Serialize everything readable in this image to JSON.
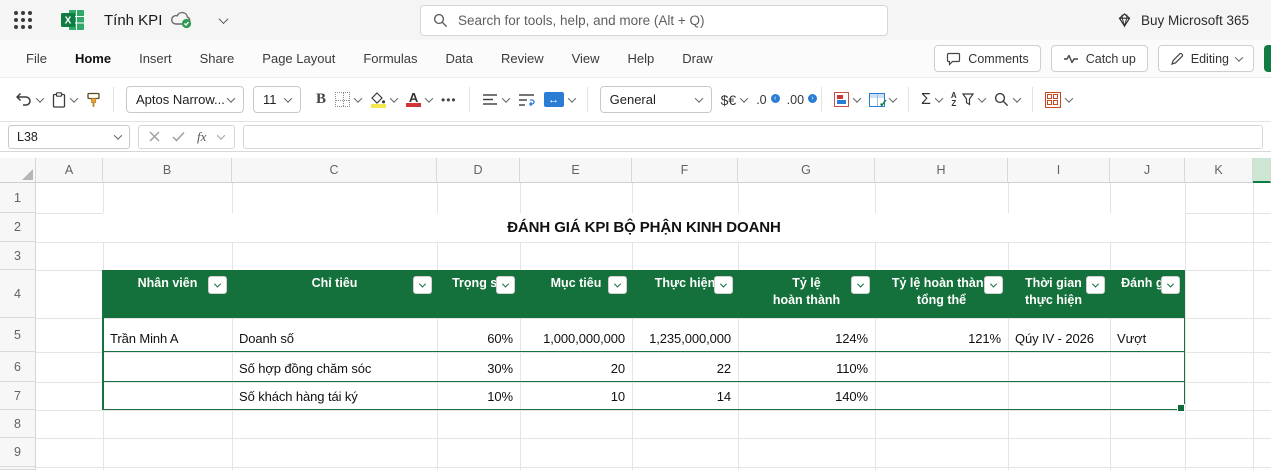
{
  "topbar": {
    "doc_title": "Tính KPI",
    "search_placeholder": "Search for tools, help, and more (Alt + Q)",
    "buy_label": "Buy Microsoft 365"
  },
  "menubar": {
    "items": [
      "File",
      "Home",
      "Insert",
      "Share",
      "Page Layout",
      "Formulas",
      "Data",
      "Review",
      "View",
      "Help",
      "Draw"
    ],
    "active_item": "Home",
    "comments_label": "Comments",
    "catchup_label": "Catch up",
    "editing_label": "Editing"
  },
  "ribbon": {
    "font_name": "Aptos Narrow...",
    "font_size": "11",
    "number_format": "General",
    "bold_glyph": "B",
    "ellipsis_glyph": "•••",
    "currency_glyph": "$€",
    "decrease_decimal_glyph": ".0",
    "increase_decimal_glyph": ".00",
    "autosum_glyph": "Σ",
    "merge_glyph": "↔",
    "sort_a": "A",
    "sort_z": "Z"
  },
  "formula_bar": {
    "name_box_value": "L38",
    "fx_glyph": "fx",
    "formula_value": ""
  },
  "grid": {
    "column_letters": [
      "A",
      "B",
      "C",
      "D",
      "E",
      "F",
      "G",
      "H",
      "I",
      "J",
      "K"
    ],
    "row_numbers": [
      "1",
      "2",
      "3",
      "4",
      "5",
      "6",
      "7",
      "8",
      "9"
    ]
  },
  "sheet": {
    "title": "ĐÁNH GIÁ KPI BỘ PHẬN KINH DOANH",
    "table": {
      "headers": [
        "Nhân viên",
        "Chỉ tiêu",
        "Trọng số",
        "Mục tiêu",
        "Thực hiện",
        "Tỷ lệ\nhoàn thành",
        "Tỷ lệ hoàn thành\ntổng thể",
        "Thời gian\nthực hiện",
        "Đánh giá"
      ],
      "rows": [
        [
          "Trần Minh A",
          "Doanh số",
          "60%",
          "1,000,000,000",
          "1,235,000,000",
          "124%",
          "121%",
          "Qúy IV - 2026",
          "Vượt"
        ],
        [
          "",
          "Số hợp đồng chăm sóc",
          "30%",
          "20",
          "22",
          "110%",
          "",
          "",
          ""
        ],
        [
          "",
          "Số khách hàng tái ký",
          "10%",
          "10",
          "14",
          "140%",
          "",
          "",
          ""
        ]
      ]
    }
  },
  "colors": {
    "table_header_green": "#15713B",
    "table_border_green": "#1c6f3f",
    "excel_green": "#107C41",
    "selected_column_bg": "#cde5d3",
    "fill_color_swatch": "#f3e94f",
    "font_color_swatch": "#d13438"
  }
}
